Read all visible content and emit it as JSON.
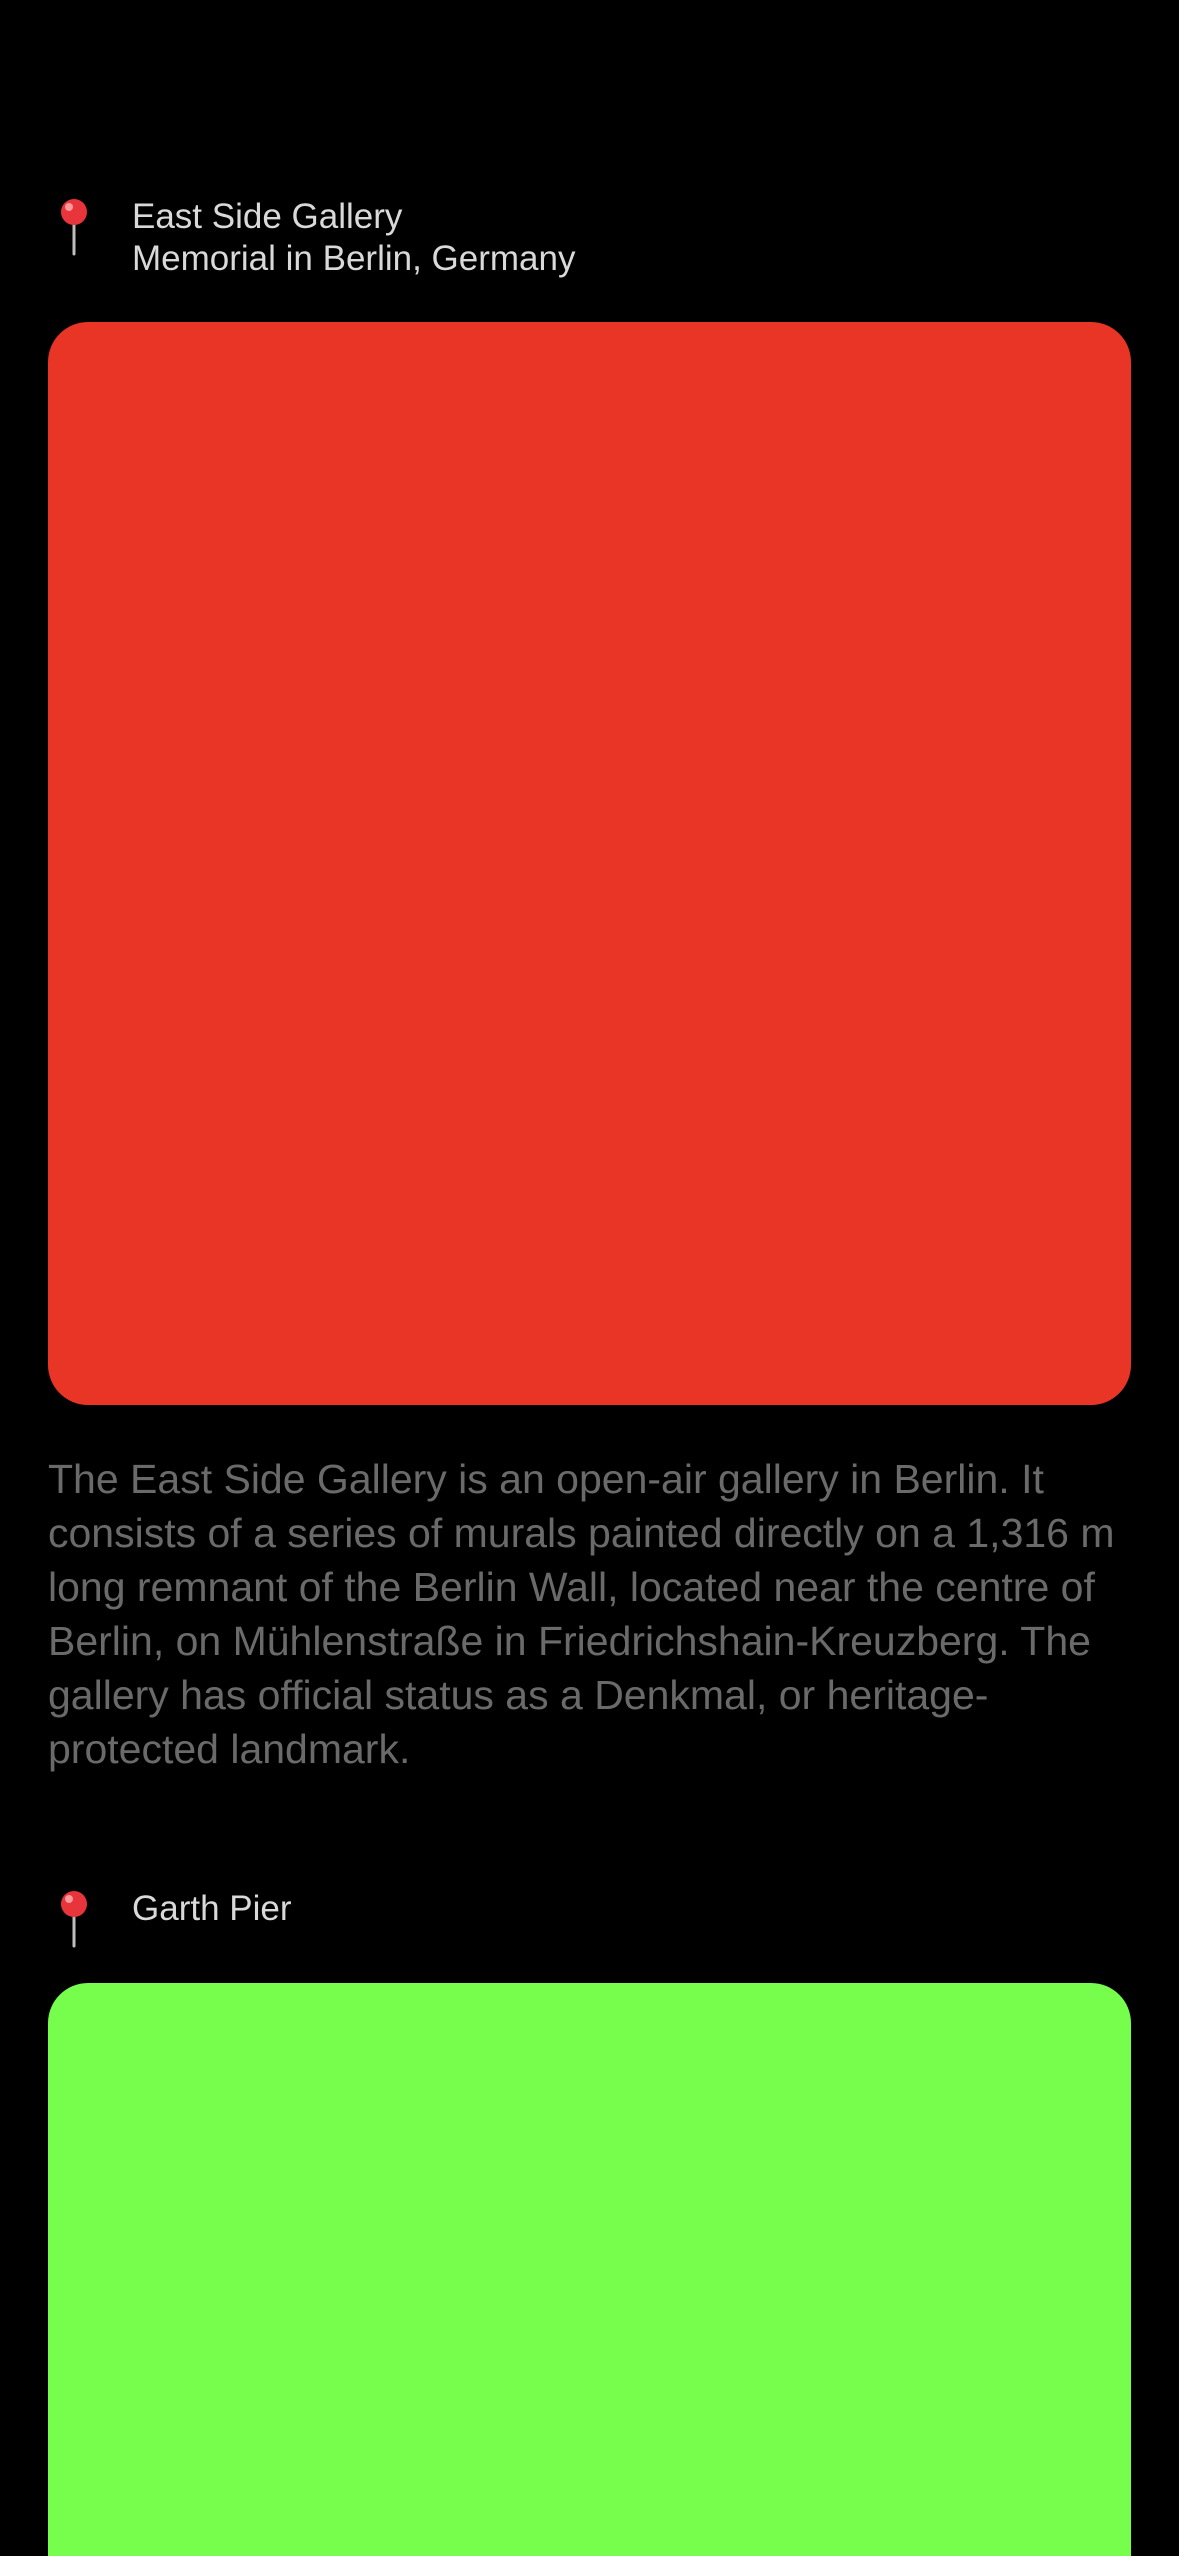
{
  "places": [
    {
      "title": "East Side Gallery",
      "subtitle": "Memorial in Berlin, Germany",
      "icon": "pin-icon",
      "image_color": "#E93526",
      "description": "The East Side Gallery is an open-air gallery in Berlin. It consists of a series of murals painted directly on a 1,316 m long remnant of the Berlin Wall, located near the centre of Berlin, on Mühlenstraße in Friedrichshain-Kreuzberg. The gallery has official status as a Denkmal, or heritage-protected landmark."
    },
    {
      "title": "Garth Pier",
      "icon": "pin-icon",
      "image_color": "#77FD4C"
    }
  ]
}
